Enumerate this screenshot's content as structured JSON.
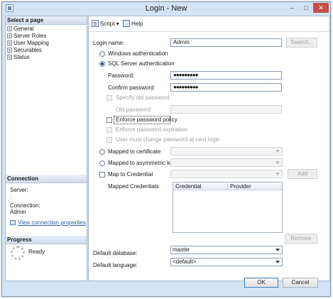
{
  "window": {
    "title": "Login - New",
    "minimize": "–",
    "maximize": "□",
    "close": "✕"
  },
  "left": {
    "select_page_header": "Select a page",
    "pages": [
      "General",
      "Server Roles",
      "User Mapping",
      "Securables",
      "Status"
    ],
    "connection_header": "Connection",
    "server_label": "Server:",
    "server_value": ".",
    "connection_label": "Connection:",
    "connection_value": "Admin",
    "view_connection_link": "View connection properties",
    "progress_header": "Progress",
    "progress_status": "Ready"
  },
  "toolbar": {
    "script_label": "Script",
    "help_label": "Help"
  },
  "form": {
    "login_name_label": "Login name:",
    "login_name_value": "Admin",
    "search_button": "Search...",
    "windows_auth": "Windows authentication",
    "sql_auth": "SQL Server authentication",
    "password_label": "Password:",
    "password_value": "●●●●●●●●●",
    "confirm_label": "Confirm password:",
    "confirm_value": "●●●●●●●●●",
    "specify_old": "Specify old password",
    "old_password_label": "Old password:",
    "enforce_policy": "Enforce password policy",
    "enforce_expiration": "Enforce password expiration",
    "must_change": "User must change password at next login",
    "mapped_cert": "Mapped to certificate",
    "mapped_asym": "Mapped to asymmetric key",
    "map_credential": "Map to Credential",
    "add_button": "Add",
    "mapped_credentials_label": "Mapped Credentials",
    "grid_col_credential": "Credential",
    "grid_col_provider": "Provider",
    "remove_button": "Remove",
    "default_db_label": "Default database:",
    "default_db_value": "master",
    "default_lang_label": "Default language:",
    "default_lang_value": "<default>"
  },
  "footer": {
    "ok_button": "OK",
    "cancel_button": "Cancel"
  }
}
